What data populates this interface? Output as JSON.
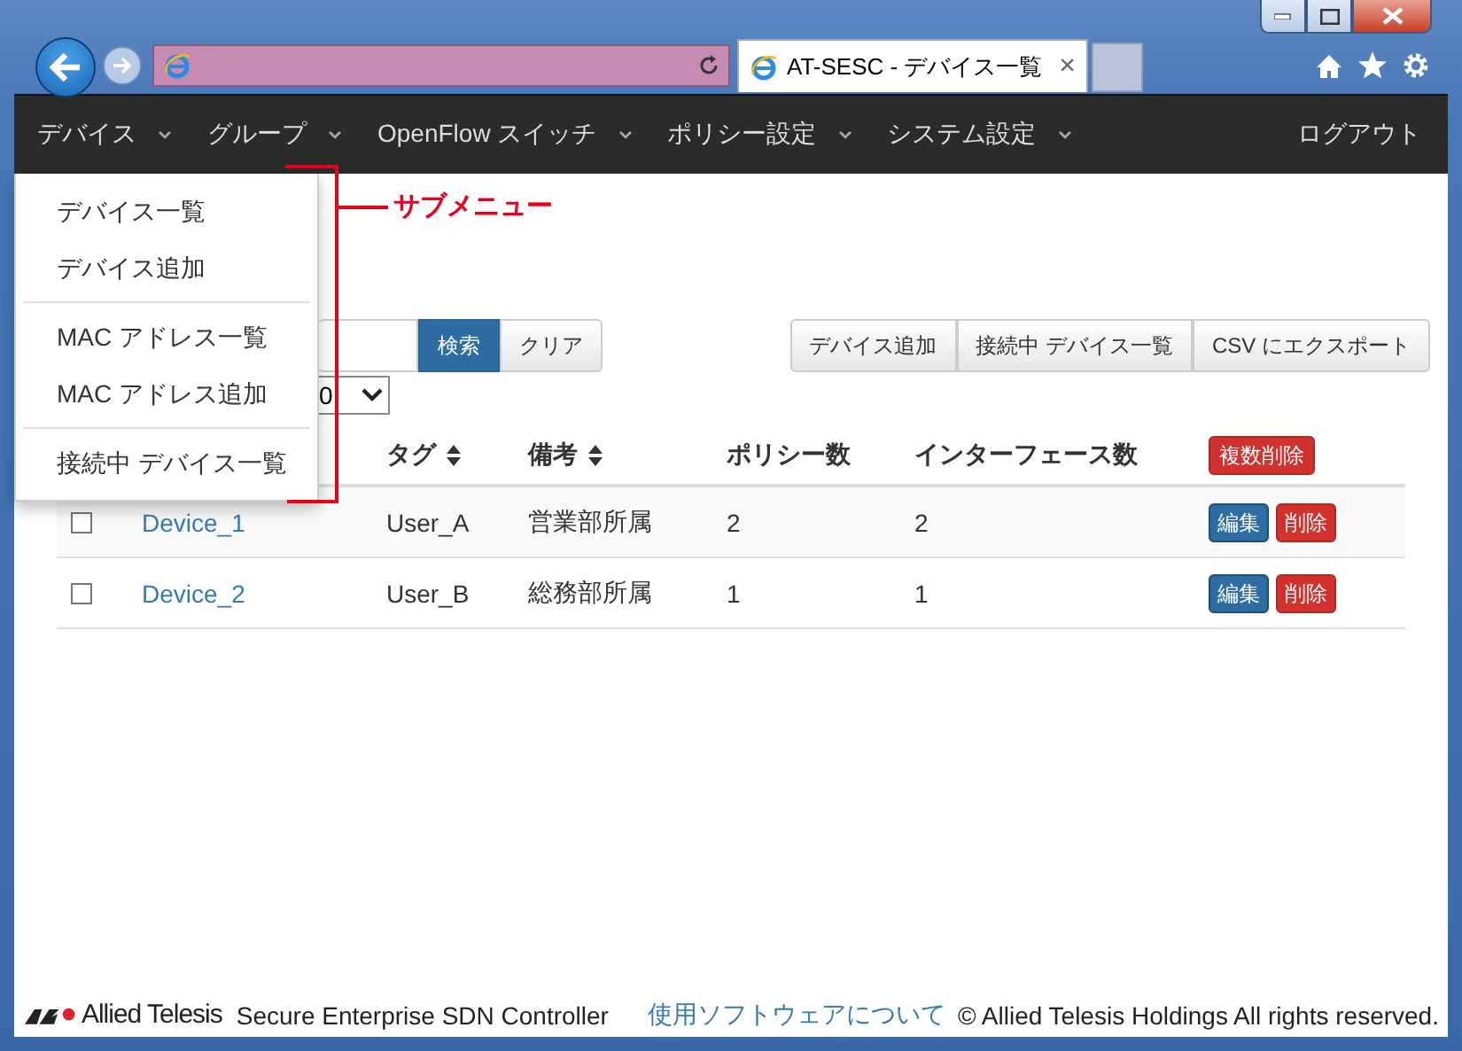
{
  "browser": {
    "tab_title": "AT-SESC - デバイス一覧",
    "tab_close": "×"
  },
  "nav": {
    "items": [
      {
        "label": "デバイス"
      },
      {
        "label": "グループ"
      },
      {
        "label": "OpenFlow スイッチ"
      },
      {
        "label": "ポリシー設定"
      },
      {
        "label": "システム設定"
      }
    ],
    "logout": "ログアウト"
  },
  "submenu": {
    "groups": [
      {
        "items": [
          "デバイス一覧",
          "デバイス追加"
        ]
      },
      {
        "items": [
          "MAC アドレス一覧",
          "MAC アドレス追加"
        ]
      },
      {
        "items": [
          "接続中 デバイス一覧"
        ]
      }
    ]
  },
  "annotation": {
    "label": "サブメニュー"
  },
  "search": {
    "search_button": "検索",
    "clear_button": "クリア",
    "page_size": "0"
  },
  "actions": [
    "デバイス追加",
    "接続中 デバイス一覧",
    "CSV にエクスポート"
  ],
  "table": {
    "columns": [
      {
        "label": "タグ",
        "sortable": true
      },
      {
        "label": "備考",
        "sortable": true
      },
      {
        "label": "ポリシー数",
        "sortable": false
      },
      {
        "label": "インターフェース数",
        "sortable": false
      }
    ],
    "bulk_delete": "複数削除",
    "rows": [
      {
        "checked": false,
        "name": "Device_1",
        "tag": "User_A",
        "note": "営業部所属",
        "policies": "2",
        "interfaces": "2",
        "edit": "編集",
        "delete": "削除"
      },
      {
        "checked": false,
        "name": "Device_2",
        "tag": "User_B",
        "note": "総務部所属",
        "policies": "1",
        "interfaces": "1",
        "edit": "編集",
        "delete": "削除"
      }
    ]
  },
  "footer": {
    "brand": "Allied Telesis",
    "product": "Secure Enterprise SDN Controller",
    "link": "使用ソフトウェアについて",
    "copyright": "© Allied Telesis Holdings All rights reserved."
  }
}
